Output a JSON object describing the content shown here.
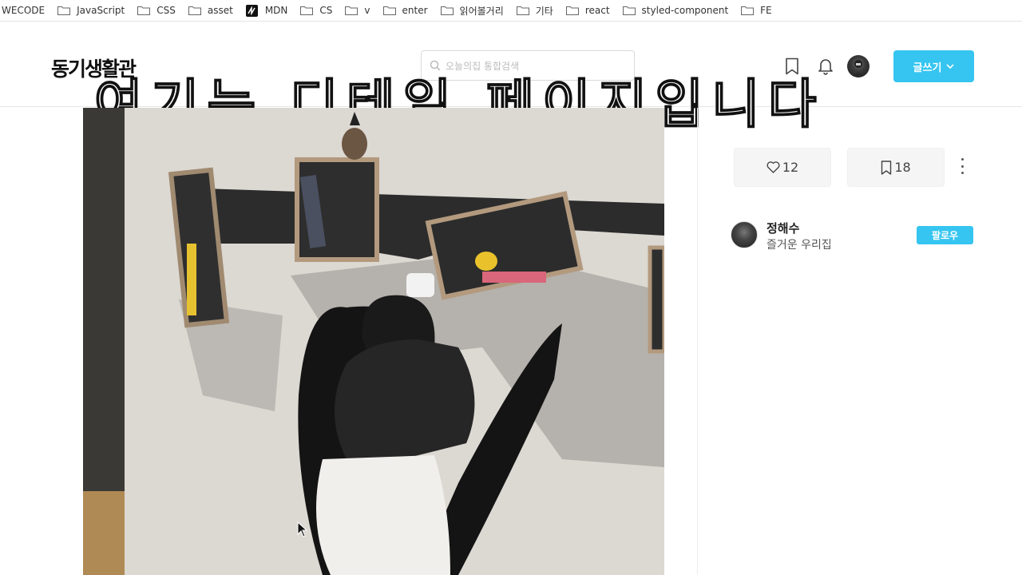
{
  "bookmarks": [
    {
      "label": "WECODE",
      "icon": "none"
    },
    {
      "label": "JavaScript",
      "icon": "folder-icon"
    },
    {
      "label": "CSS",
      "icon": "folder-icon"
    },
    {
      "label": "asset",
      "icon": "folder-icon"
    },
    {
      "label": "MDN",
      "icon": "mdn-logo-icon"
    },
    {
      "label": "CS",
      "icon": "folder-icon"
    },
    {
      "label": "v",
      "icon": "folder-icon"
    },
    {
      "label": "enter",
      "icon": "folder-icon"
    },
    {
      "label": "읽어볼거리",
      "icon": "folder-icon"
    },
    {
      "label": "기타",
      "icon": "folder-icon"
    },
    {
      "label": "react",
      "icon": "folder-icon"
    },
    {
      "label": "styled-component",
      "icon": "folder-icon"
    },
    {
      "label": "FE",
      "icon": "folder-icon"
    }
  ],
  "header": {
    "logo": "동기생활관",
    "search_placeholder": "오늘의집 통합검색",
    "overlay_caption": "여기는 디테일 페이지입니다",
    "write_button": "글쓰기"
  },
  "post": {
    "photo_alt": "전시 공간에서 의자에 앉아 있는 사람 사진"
  },
  "sidebar": {
    "likes": "12",
    "scraps": "18",
    "author": {
      "name": "정해수",
      "bio": "즐거운 우리집",
      "follow_label": "팔로우"
    }
  },
  "colors": {
    "accent": "#35c5f0"
  }
}
